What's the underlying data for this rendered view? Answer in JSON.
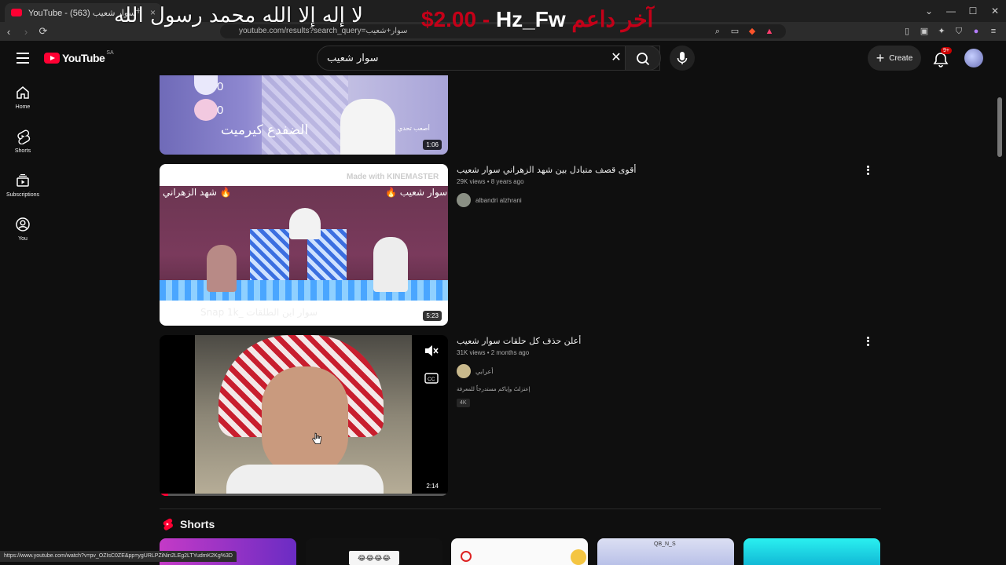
{
  "browser": {
    "tab_title": "YouTube - سوار شعيب (563)",
    "tab_close": "×",
    "new_tab": "+",
    "url": "youtube.com/results?search_query=سوار+شعيب",
    "status_url": "https://www.youtube.com/watch?v=pv_OZIsC0ZE&pp=ygURLPZiNin2LEg2LTYudmK2Kg%3D",
    "win_min": "—",
    "win_max": "☐",
    "win_close": "✕"
  },
  "overlay": {
    "shahada": "لا إله إلا الله محمد رسول الله",
    "donation_price": "$2.00 - ",
    "donation_name": "Hz_Fw",
    "donation_label": "آخر داعم"
  },
  "header": {
    "logo_text": "YouTube",
    "country_code": "SA",
    "search_value": "سوار شعيب",
    "create_label": "Create",
    "notif_badge": "9+"
  },
  "sidebar": {
    "items": [
      {
        "label": "Home"
      },
      {
        "label": "Shorts"
      },
      {
        "label": "Subscriptions"
      },
      {
        "label": "You"
      }
    ]
  },
  "results": [
    {
      "duration": "1:06",
      "thumb_text": "الضفدع كيرميت",
      "thumb_score1": "0",
      "thumb_score2": "0",
      "thumb_badge": "أصعب تحدي"
    },
    {
      "title": "أقوى قصف متبادل بين شهد الزهراني سوار شعيب",
      "views": "29K views",
      "age": "8 years ago",
      "channel": "albandri alzhrani",
      "duration": "5:23",
      "thumb_watermark": "Made with KINEMASTER",
      "thumb_left_name": "شهد الزهراني 🔥",
      "thumb_right_name": "🔥 سوار شعيب",
      "thumb_bottom": "Snap 1k_ سوار ابن الطلقات"
    },
    {
      "title": "أعلن حذف كل حلقات سوار شعيب",
      "views": "31K views",
      "age": "2 months ago",
      "channel": "أعرابي",
      "description": "إعتزلتُ وإياكم مستدرجاً للمعرفة",
      "tag": "4K",
      "duration": "2:14"
    }
  ],
  "shorts": {
    "heading": "Shorts",
    "card3_text": "😂😂😂😂",
    "card4_text": "QB_N_S"
  },
  "colors": {
    "brand_red": "#ff0033",
    "background": "#0f0f0f",
    "donation_red": "#c40018"
  }
}
